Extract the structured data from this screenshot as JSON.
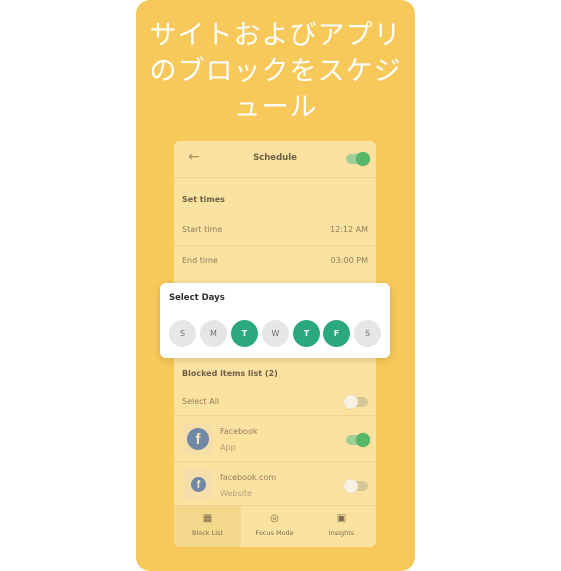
{
  "headline": [
    "サイトおよびアプリ",
    "のブロックをスケジ",
    "ュール"
  ],
  "appbar": {
    "back_icon": "arrow-left-icon",
    "title": "Schedule",
    "toggle_on": true
  },
  "set_times": {
    "heading": "Set times",
    "start_label": "Start time",
    "start_value": "12:12 AM",
    "end_label": "End time",
    "end_value": "03:00 PM"
  },
  "select_days": {
    "title": "Select Days",
    "days": [
      {
        "label": "S",
        "selected": false
      },
      {
        "label": "M",
        "selected": false
      },
      {
        "label": "T",
        "selected": true
      },
      {
        "label": "W",
        "selected": false
      },
      {
        "label": "T",
        "selected": true
      },
      {
        "label": "F",
        "selected": true
      },
      {
        "label": "S",
        "selected": false
      }
    ],
    "selected_color": "#2ba97d"
  },
  "blocked": {
    "heading": "Blocked items list (2)",
    "select_all": "Select All",
    "items": [
      {
        "name": "Facebook",
        "type": "App",
        "icon": "facebook-icon",
        "enabled": true
      },
      {
        "name": "facebook.com",
        "type": "Website",
        "icon": "facebook-icon",
        "enabled": false
      }
    ]
  },
  "bottom_nav": [
    {
      "label": "Block List",
      "icon": "grid-icon",
      "active": true
    },
    {
      "label": "Focus Mode",
      "icon": "target-icon",
      "active": false
    },
    {
      "label": "Insights",
      "icon": "chart-icon",
      "active": false
    }
  ],
  "colors": {
    "promo_bg": "#f7c95a",
    "phone_bg": "#fbe2a0",
    "toggle_on": "#53b868"
  }
}
